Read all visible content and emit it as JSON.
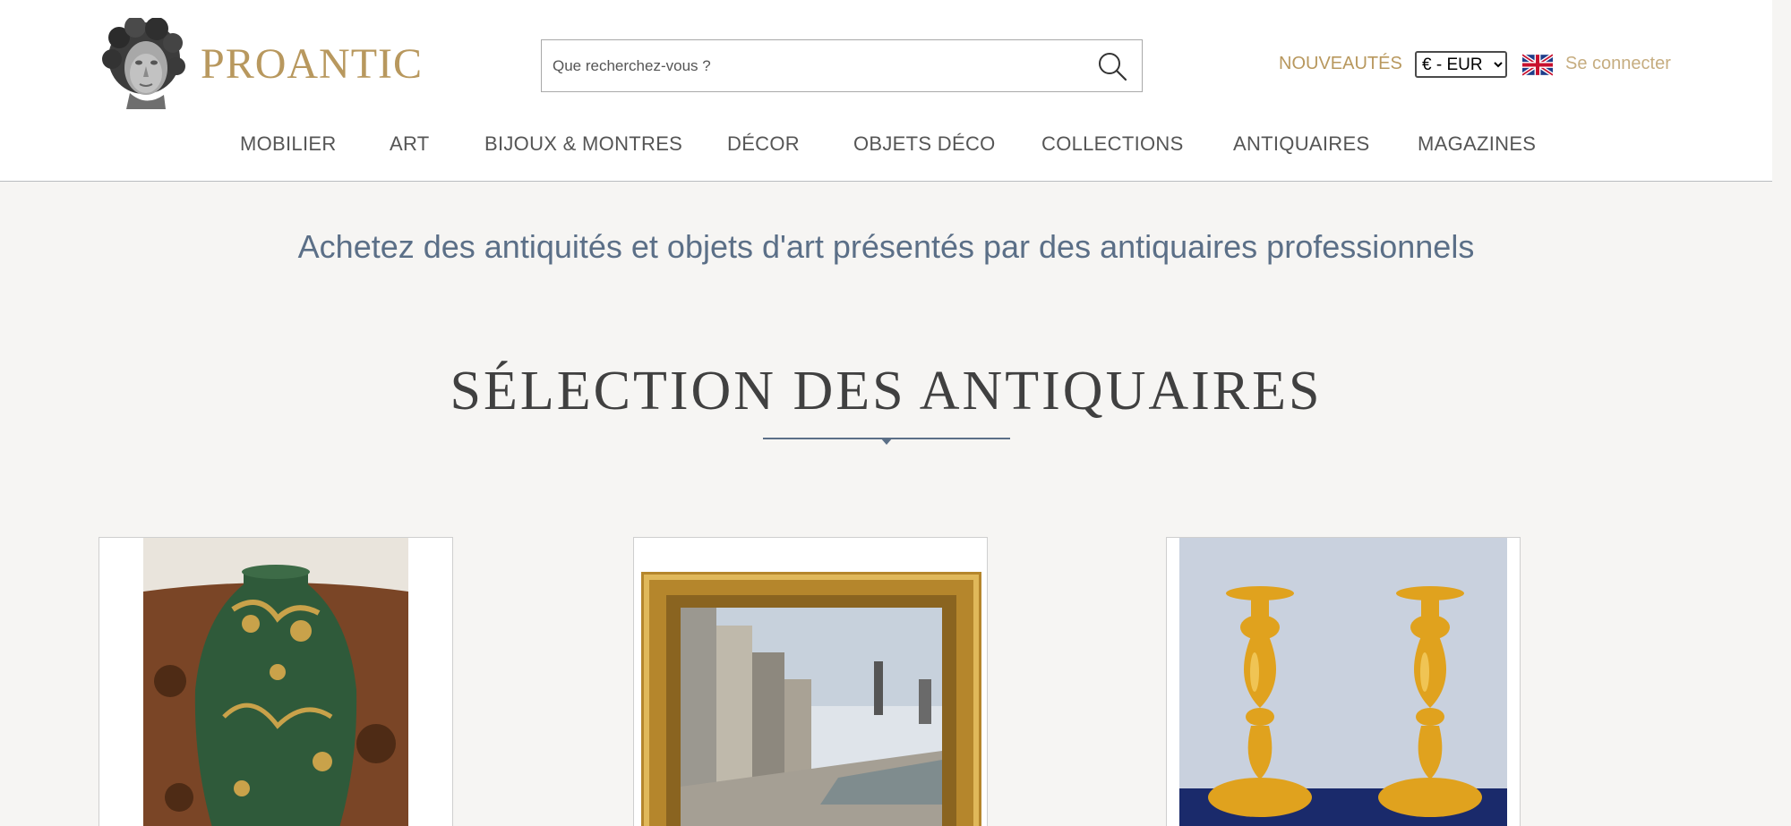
{
  "header": {
    "logo_text": "PROANTIC",
    "search": {
      "placeholder": "Que recherchez-vous ?"
    },
    "nouveautes_label": "NOUVEAUTÉS",
    "currency": {
      "selected": "€ - EUR"
    },
    "language_icon": "uk-flag-icon",
    "login_label": "Se connecter"
  },
  "nav": {
    "items": [
      {
        "label": "MOBILIER"
      },
      {
        "label": "ART"
      },
      {
        "label": "BIJOUX & MONTRES"
      },
      {
        "label": "DÉCOR"
      },
      {
        "label": "OBJETS DÉCO"
      },
      {
        "label": "COLLECTIONS"
      },
      {
        "label": "ANTIQUAIRES"
      },
      {
        "label": "MAGAZINES"
      }
    ]
  },
  "main": {
    "tagline": "Achetez des antiquités et objets d'art présentés par des antiquaires professionnels",
    "section_title": "SÉLECTION DES ANTIQUAIRES",
    "products": [
      {
        "image": "art-nouveau-green-vase"
      },
      {
        "image": "framed-harbour-painting"
      },
      {
        "image": "gilt-bronze-candlesticks"
      }
    ]
  },
  "colors": {
    "brand_gold": "#b8985e",
    "accent_blue": "#5b6f87",
    "background": "#f6f5f3"
  }
}
